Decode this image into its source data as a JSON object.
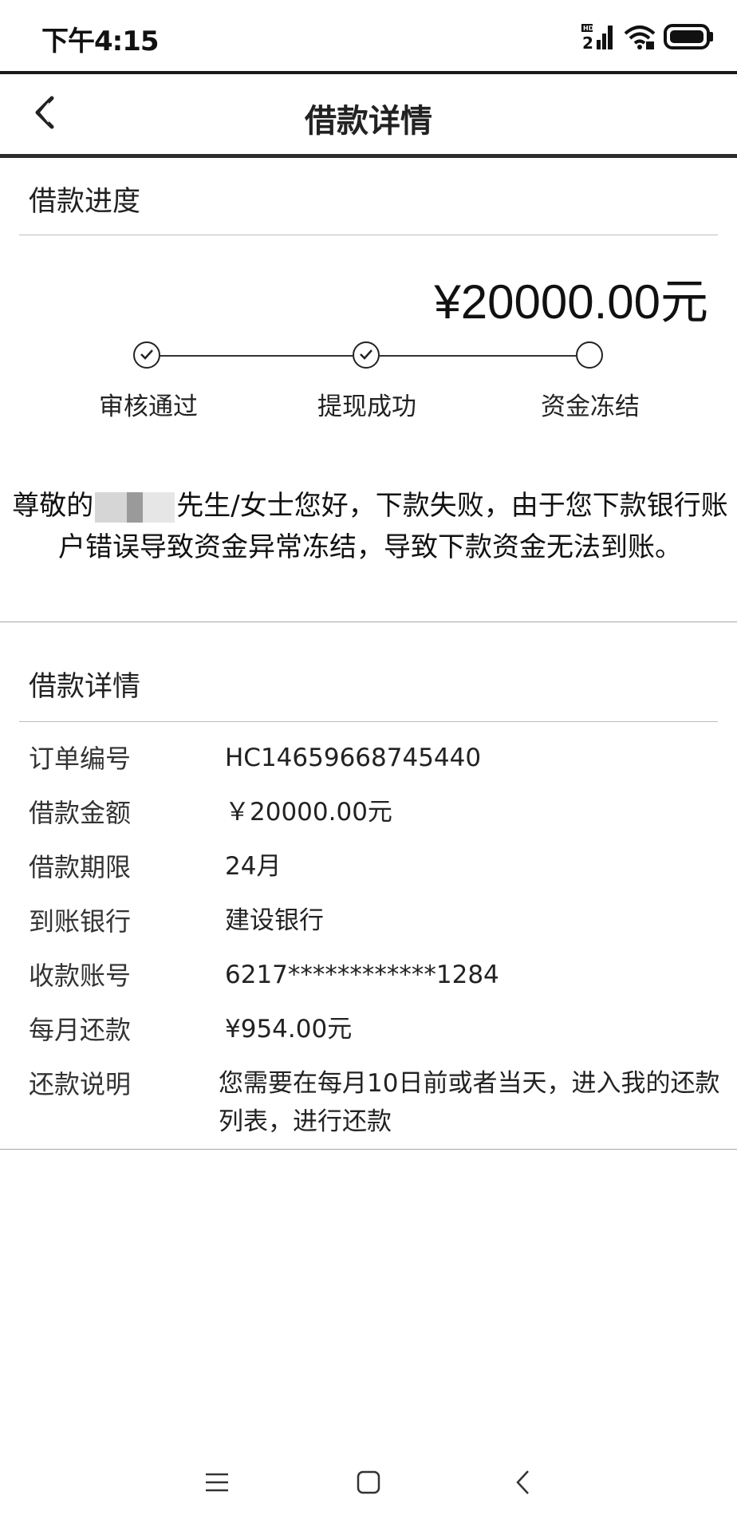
{
  "status_bar": {
    "time": "下午4:15",
    "signal_icon": "signal-hd-icon",
    "wifi_icon": "wifi-icon",
    "battery_icon": "battery-icon"
  },
  "nav": {
    "back_icon": "chevron-left-icon",
    "title": "借款详情"
  },
  "progress": {
    "heading": "借款进度",
    "amount": "¥20000.00元",
    "steps": [
      {
        "label": "审核通过",
        "done": true
      },
      {
        "label": "提现成功",
        "done": true
      },
      {
        "label": "资金冻结",
        "done": false
      }
    ]
  },
  "notice": {
    "prefix": "尊敬的",
    "suffix": "先生/女士您好，下款失败，由于您下款银行账户错误导致资金异常冻结，导致下款资金无法到账。"
  },
  "details": {
    "heading": "借款详情",
    "rows": [
      {
        "label": "订单编号",
        "value": "HC14659668745440"
      },
      {
        "label": "借款金额",
        "value": "￥20000.00元"
      },
      {
        "label": "借款期限",
        "value": "24月"
      },
      {
        "label": "到账银行",
        "value": "建设银行"
      },
      {
        "label": "收款账号",
        "value": "6217************1284"
      },
      {
        "label": "每月还款",
        "value": "¥954.00元"
      },
      {
        "label": "还款说明",
        "value": "您需要在每月10日前或者当天，进入我的还款列表，进行还款"
      }
    ]
  },
  "system_nav": {
    "menu_icon": "menu-icon",
    "home_icon": "home-icon",
    "back_icon": "back-icon"
  }
}
